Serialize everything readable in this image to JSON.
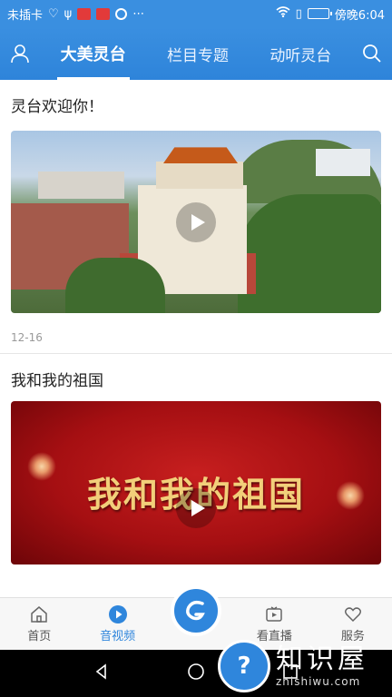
{
  "status_bar": {
    "carrier": "未插卡",
    "time": "傍晚6:04"
  },
  "header": {
    "tabs": [
      {
        "label": "大美灵台",
        "active": true
      },
      {
        "label": "栏目专题",
        "active": false
      },
      {
        "label": "动听灵台",
        "active": false
      }
    ]
  },
  "feed": [
    {
      "title": "灵台欢迎你！",
      "date": "12-16"
    },
    {
      "title": "我和我的祖国",
      "date": "",
      "overlay_text": "我和我的祖国"
    }
  ],
  "bottom_nav": {
    "items": [
      {
        "label": "首页",
        "active": false
      },
      {
        "label": "音视频",
        "active": true
      },
      {
        "label": "看直播",
        "active": false
      },
      {
        "label": "服务",
        "active": false
      }
    ]
  },
  "watermark": {
    "text": "知识屋",
    "sub": "zhishiwu.com",
    "badge": "?"
  },
  "colors": {
    "primary": "#2f86dc",
    "header_bg": "#3a8fe0"
  }
}
